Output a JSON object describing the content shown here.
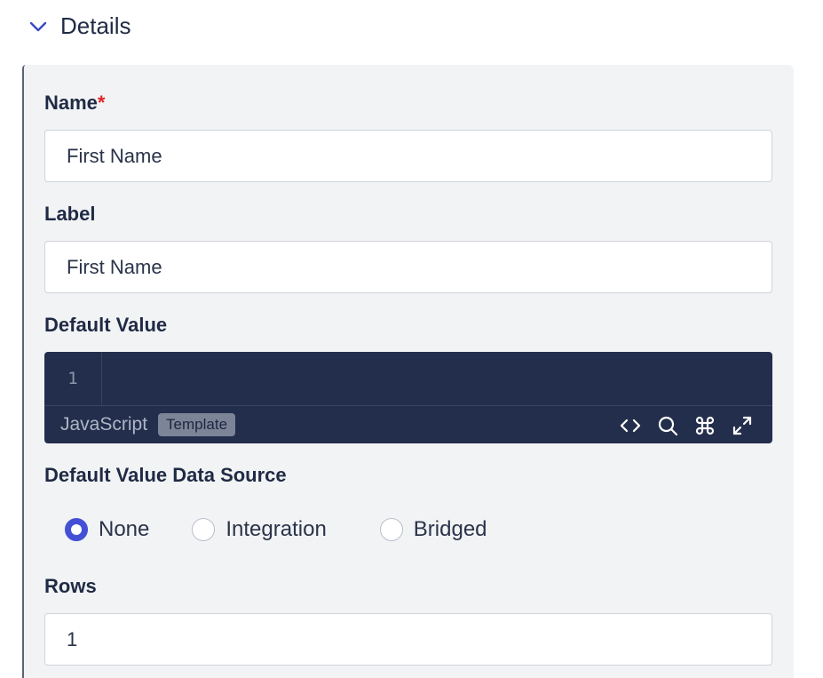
{
  "section": {
    "title": "Details",
    "expanded": true
  },
  "fields": {
    "name": {
      "label": "Name",
      "required_mark": "*",
      "value": "First Name"
    },
    "label": {
      "label": "Label",
      "value": "First Name"
    },
    "default_value": {
      "label": "Default Value",
      "editor": {
        "line_number": "1",
        "code": "",
        "language": "JavaScript",
        "mode_badge": "Template",
        "tools": [
          "code-brackets-icon",
          "search-icon",
          "command-icon",
          "expand-icon"
        ]
      }
    },
    "data_source": {
      "label": "Default Value Data Source",
      "options": [
        {
          "label": "None",
          "checked": true
        },
        {
          "label": "Integration",
          "checked": false
        },
        {
          "label": "Bridged",
          "checked": false
        }
      ]
    },
    "rows": {
      "label": "Rows",
      "value": "1"
    }
  },
  "colors": {
    "accent": "#4350d6",
    "required": "#e02424",
    "editor_bg": "#232e4c",
    "panel_bg": "#f2f3f5"
  }
}
